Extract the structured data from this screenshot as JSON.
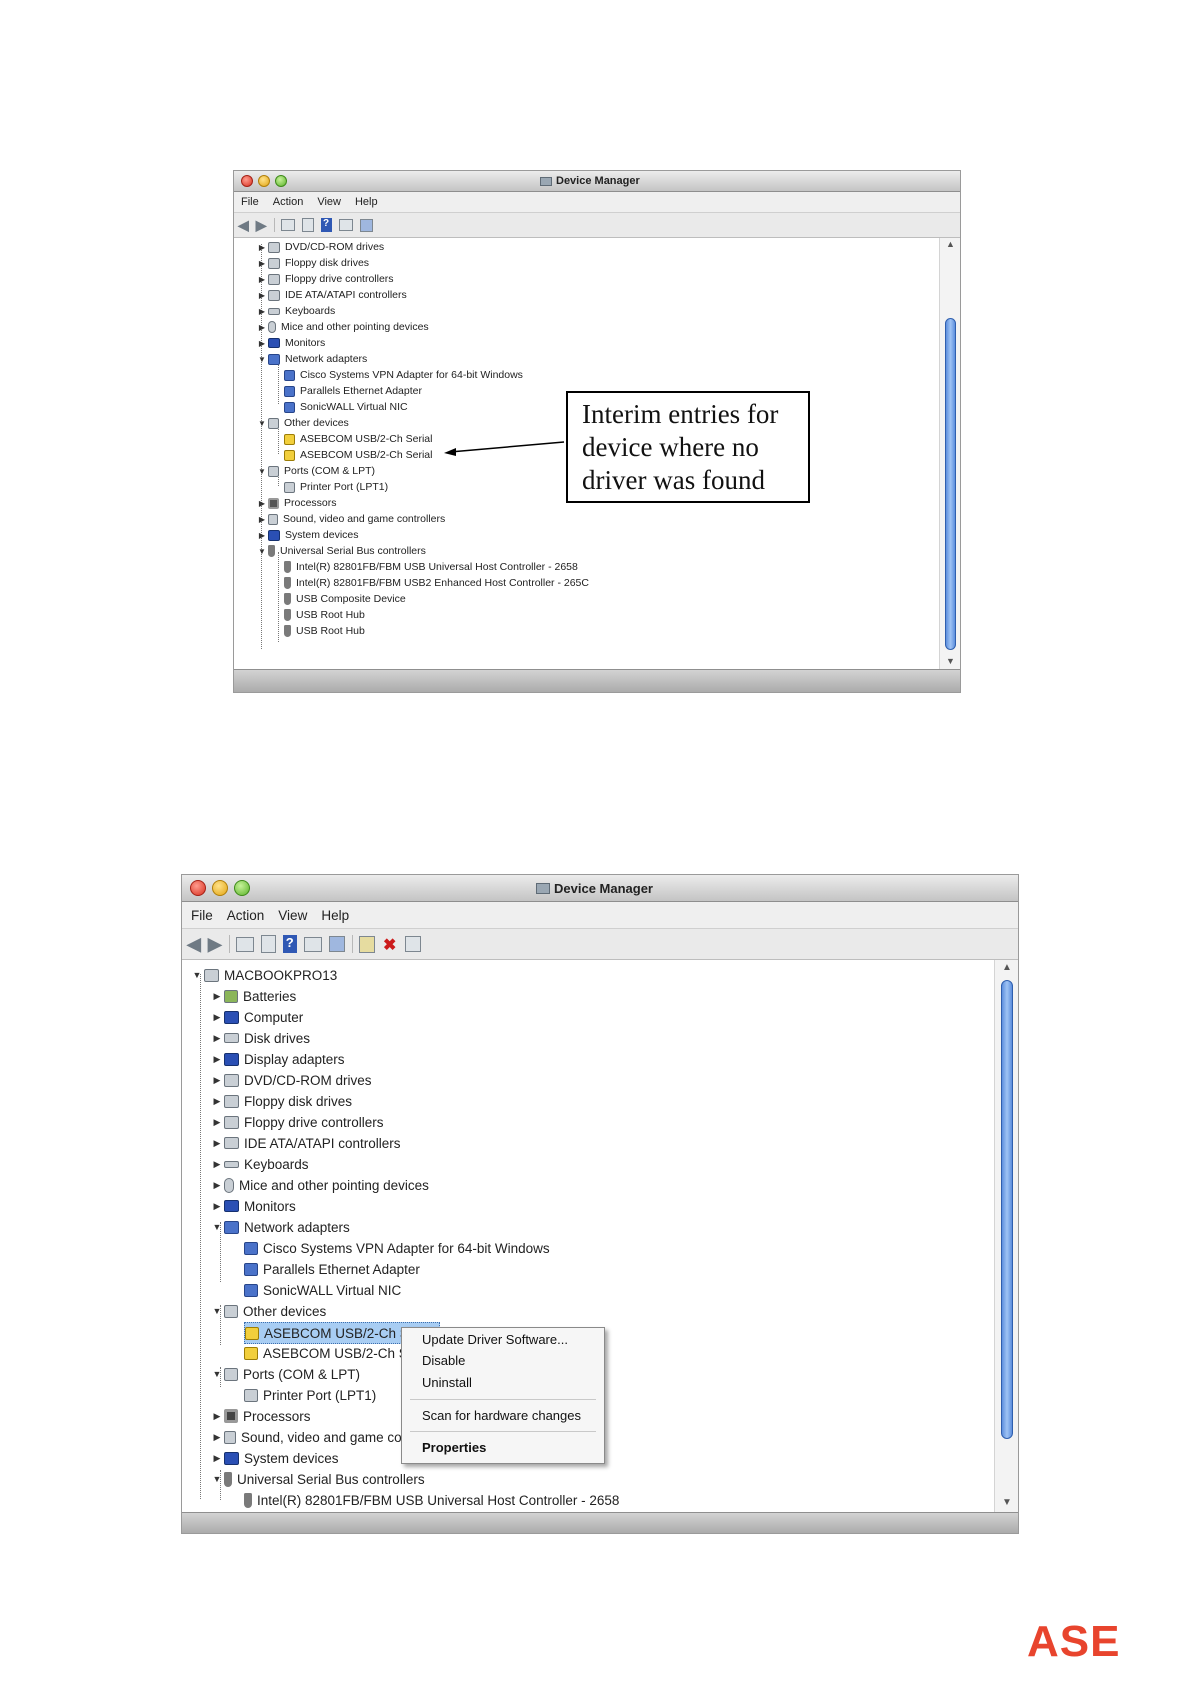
{
  "window1": {
    "title": "Device Manager",
    "menus": [
      "File",
      "Action",
      "View",
      "Help"
    ],
    "tree": [
      "DVD/CD-ROM drives",
      "Floppy disk drives",
      "Floppy drive controllers",
      "IDE ATA/ATAPI controllers",
      "Keyboards",
      "Mice and other pointing devices",
      "Monitors",
      "Network adapters",
      "Cisco Systems VPN Adapter for 64-bit Windows",
      "Parallels Ethernet Adapter",
      "SonicWALL Virtual NIC",
      "Other devices",
      "ASEBCOM USB/2-Ch Serial",
      "ASEBCOM USB/2-Ch Serial",
      "Ports (COM & LPT)",
      "Printer Port (LPT1)",
      "Processors",
      "Sound, video and game controllers",
      "System devices",
      "Universal Serial Bus controllers",
      "Intel(R) 82801FB/FBM USB Universal Host Controller - 2658",
      "Intel(R) 82801FB/FBM USB2 Enhanced Host Controller - 265C",
      "USB Composite Device",
      "USB Root Hub",
      "USB Root Hub"
    ],
    "callout": [
      "Interim entries for",
      "device where no",
      "driver was found"
    ]
  },
  "window2": {
    "title": "Device Manager",
    "menus": [
      "File",
      "Action",
      "View",
      "Help"
    ],
    "tree": [
      "MACBOOKPRO13",
      "Batteries",
      "Computer",
      "Disk drives",
      "Display adapters",
      "DVD/CD-ROM drives",
      "Floppy disk drives",
      "Floppy drive controllers",
      "IDE ATA/ATAPI controllers",
      "Keyboards",
      "Mice and other pointing devices",
      "Monitors",
      "Network adapters",
      "Cisco Systems VPN Adapter for 64-bit Windows",
      "Parallels Ethernet Adapter",
      "SonicWALL Virtual NIC",
      "Other devices",
      "ASEBCOM USB/2-Ch S",
      "ASEBCOM USB/2-Ch S",
      "Ports (COM & LPT)",
      "Printer Port (LPT1)",
      "Processors",
      "Sound, video and game co",
      "System devices",
      "Universal Serial Bus controllers",
      "Intel(R) 82801FB/FBM USB Universal Host Controller - 2658"
    ],
    "context_menu": {
      "update": "Update Driver Software...",
      "disable": "Disable",
      "uninstall": "Uninstall",
      "scan": "Scan for hardware changes",
      "properties": "Properties"
    }
  },
  "logo": "ASE",
  "colors": {
    "accent": "#e8442d",
    "selection": "#a8cdf3",
    "scroll_thumb": "#5d8fde"
  }
}
